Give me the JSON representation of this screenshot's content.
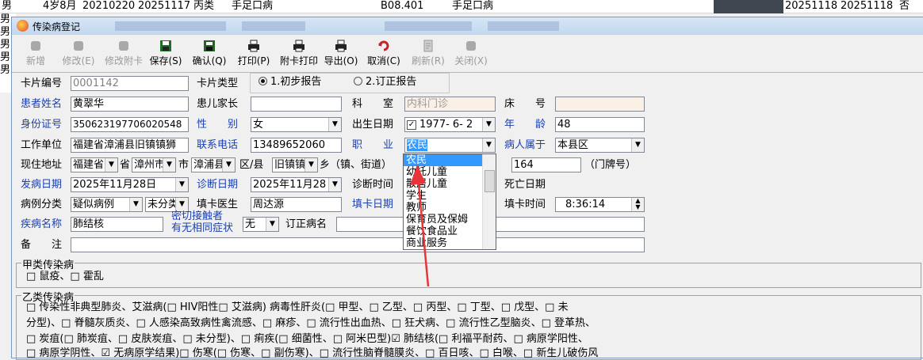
{
  "background": {
    "row1": [
      "男",
      "4岁8月",
      "20210220",
      "20251117",
      "丙类",
      "手足口病",
      "B08.401",
      "手足口病",
      "20251118",
      "20251118",
      "否"
    ],
    "left_col": [
      "男",
      "男",
      "男",
      "男",
      "男"
    ]
  },
  "window": {
    "title": "传染病登记"
  },
  "toolbar": [
    {
      "label": "新增",
      "enabled": false
    },
    {
      "label": "修改(E)",
      "enabled": false
    },
    {
      "label": "修改附卡",
      "enabled": false
    },
    {
      "label": "保存(S)",
      "enabled": true
    },
    {
      "label": "确认(Q)",
      "enabled": true
    },
    {
      "label": "打印(P)",
      "enabled": true
    },
    {
      "label": "附卡打印",
      "enabled": true
    },
    {
      "label": "导出(O)",
      "enabled": true
    },
    {
      "label": "取消(C)",
      "enabled": true
    },
    {
      "label": "刷新(R)",
      "enabled": false
    },
    {
      "label": "关闭(X)",
      "enabled": false
    }
  ],
  "form": {
    "card_no_label": "卡片编号",
    "card_no": "0001142",
    "card_type_label": "卡片类型",
    "card_type_opt1": "1.初步报告",
    "card_type_opt2": "2.订正报告",
    "patient_name_label": "患者姓名",
    "patient_name": "黄翠华",
    "guardian_label": "患儿家长",
    "guardian": "",
    "dept_label": "科　　室",
    "dept": "内科门诊",
    "bed_label": "床　　号",
    "bed": "",
    "id_label": "身份证号",
    "id_no": "350623197706020548",
    "gender_label": "性　　别",
    "gender": "女",
    "birth_label": "出生日期",
    "birth": "1977- 6- 2",
    "age_label": "年　　龄",
    "age": "48",
    "work_label": "工作单位",
    "work": "福建省漳浦县旧镇镇狮",
    "phone_label": "联系电话",
    "phone": "13489652060",
    "job_label": "职　　业",
    "job": "农民",
    "belong_label": "病人属于",
    "belong": "本县区",
    "addr_label": "现住地址",
    "province": "福建省",
    "province_suffix": "省",
    "city": "漳州市",
    "city_suffix": "市",
    "county": "漳浦县",
    "county_suffix": "区/县",
    "town": "旧镇镇",
    "town_suffix": "乡（镇、街道）",
    "house_no": "164",
    "house_suffix": "（门牌号）",
    "onset_label": "发病日期",
    "onset": "2025年11月28日",
    "diag_date_label": "诊断日期",
    "diag_date": "2025年11月28",
    "diag_time_label": "诊断时间",
    "death_label": "死亡日期",
    "class_label": "病例分类",
    "class1": "疑似病例",
    "class2": "未分类",
    "doctor_label": "填卡医生",
    "doctor": "周达源",
    "fill_date_label": "填卡日期",
    "fill_time_label": "填卡时间",
    "fill_time": "8:36:14",
    "disease_label": "疾病名称",
    "disease": "肺结核",
    "contact_label1": "密切接触者",
    "contact_label2": "有无相同症状",
    "contact": "无",
    "revised_label": "订正病名",
    "remark_label": "备　　注"
  },
  "job_dropdown": [
    "农民",
    "幼托儿童",
    "散居儿童",
    "学生",
    "教师",
    "保育员及保姆",
    "餐饮食品业",
    "商业服务"
  ],
  "groupA": {
    "title": "甲类传染病",
    "line": "□ 鼠疫、□ 霍乱"
  },
  "groupB": {
    "title": "乙类传染病",
    "line1": "□ 传染性非典型肺炎、艾滋病(□ HIV阳性□ 艾滋病) 病毒性肝炎(□ 甲型、□ 乙型、□ 丙型、□ 丁型、□ 戊型、□ 未",
    "line2": "分型)、□ 脊髓灰质炎、□ 人感染高致病性禽流感、□ 麻疹、□ 流行性出血热、□ 狂犬病、□ 流行性乙型脑炎、□ 登革热、",
    "line3": "□ 炭疽(□ 肺炭疽、□ 皮肤炭疽、□ 未分型)、□ 痢疾(□ 细菌性、□ 阿米巴型)☑ 肺结核(□ 利福平耐药、□ 病原学阳性、",
    "line4": "□ 病原学阴性、☑ 无病原学结果)□ 伤寒(□ 伤寒、□ 副伤寒)、□ 流行性脑脊髓膜炎、□ 百日咳、□ 白喉、□ 新生儿破伤风"
  }
}
